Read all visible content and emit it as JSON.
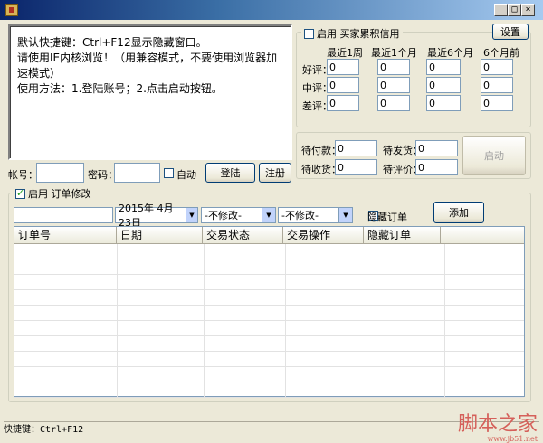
{
  "window": {
    "min": "_",
    "max": "□",
    "close": "×"
  },
  "notes": {
    "line1": "默认快捷键：Ctrl+F12显示隐藏窗口。",
    "line2": "请使用IE内核浏览！（用兼容模式，不要使用浏览器加速模式）",
    "line3": "使用方法：1.登陆账号；2.点击启动按钮。"
  },
  "login": {
    "account_label": "帐号：",
    "password_label": "密码：",
    "auto_label": "自动",
    "login_button": "登陆",
    "register_button": "注册"
  },
  "credit": {
    "enable_label": "启用  买家累积信用",
    "settings_button": "设置",
    "columns": [
      "最近1周",
      "最近1个月",
      "最近6个月",
      "6个月前"
    ],
    "rows": [
      {
        "label": "好评：",
        "values": [
          "0",
          "0",
          "0",
          "0"
        ]
      },
      {
        "label": "中评：",
        "values": [
          "0",
          "0",
          "0",
          "0"
        ]
      },
      {
        "label": "差评：",
        "values": [
          "0",
          "0",
          "0",
          "0"
        ]
      }
    ]
  },
  "pending": {
    "pay_label": "待付款：",
    "pay_value": "0",
    "ship_label": "待发货：",
    "ship_value": "0",
    "receive_label": "待收货：",
    "receive_value": "0",
    "review_label": "待评价：",
    "review_value": "0",
    "start_button": "启动"
  },
  "orders": {
    "enable_label": "启用 订单修改",
    "date_value": "2015年  4月23日",
    "status_select": "-不修改-",
    "action_select": "-不修改-",
    "hide_label": "隐藏订单",
    "add_button": "添加",
    "columns": [
      "订单号",
      "日期",
      "交易状态",
      "交易操作",
      "隐藏订单"
    ]
  },
  "statusbar": {
    "text": "快捷键：Ctrl+F12"
  },
  "watermark": {
    "main": "脚本之家",
    "sub": "www.jb51.net"
  }
}
